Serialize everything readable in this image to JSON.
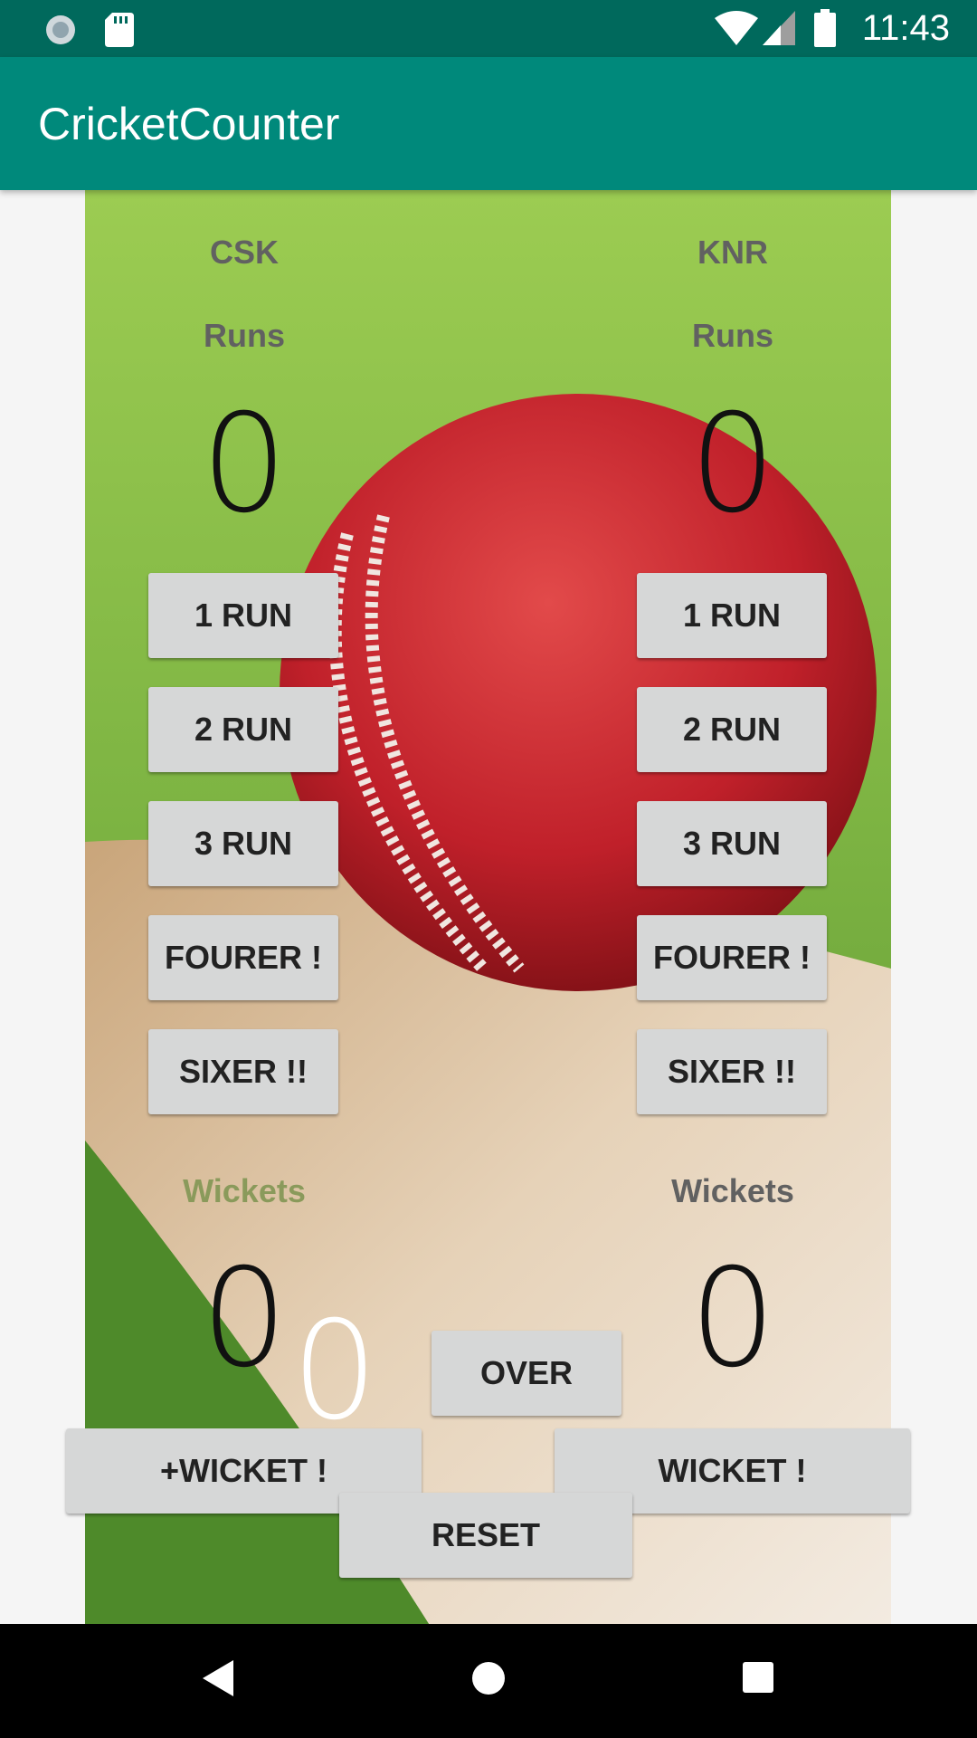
{
  "status_bar": {
    "time": "11:43"
  },
  "app_bar": {
    "title": "CricketCounter"
  },
  "team_a": {
    "name": "CSK",
    "runs_label": "Runs",
    "runs": "0",
    "buttons": [
      "1 RUN",
      "2 RUN",
      "3 RUN",
      "FOURER !",
      "SIXER !!"
    ],
    "wickets_label": "Wickets",
    "wickets": "0",
    "wicket_button": "+WICKET !"
  },
  "team_b": {
    "name": "KNR",
    "runs_label": "Runs",
    "runs": "0",
    "buttons": [
      "1 RUN",
      "2 RUN",
      "3 RUN",
      "FOURER !",
      "SIXER !!"
    ],
    "wickets_label": "Wickets",
    "wickets": "0",
    "wicket_button": "WICKET !"
  },
  "over": {
    "count": "0",
    "button": "OVER"
  },
  "reset_button": "RESET",
  "colors": {
    "status_bar": "#00695c",
    "app_bar": "#00897b",
    "button": "#d6d7d7"
  }
}
